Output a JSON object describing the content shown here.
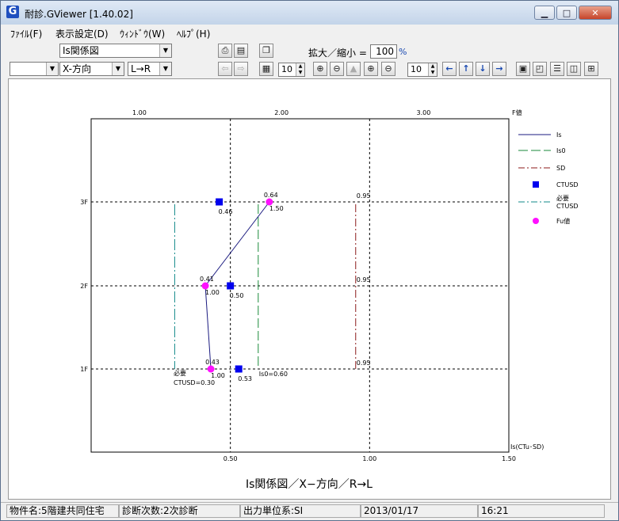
{
  "window": {
    "title": "耐診.GViewer [1.40.02]",
    "app_icon": "G",
    "minimize": "▁",
    "maximize": "□",
    "close": "✕"
  },
  "menu": {
    "items": [
      "ﾌｧｲﾙ(F)",
      "表示設定(D)",
      "ｳｨﾝﾄﾞｳ(W)",
      "ﾍﾙﾌﾟ(H)"
    ]
  },
  "toolbar": {
    "view_select": "Is関係図",
    "blank_select": "",
    "direction_select": "X-方向",
    "lr_select": "L→R",
    "zoom_label": "拡大／縮小 =",
    "zoom_value": "100",
    "zoom_unit": "%",
    "spin1_value": "10",
    "spin2_value": "10"
  },
  "chart_data": {
    "type": "scatter",
    "title": "Is関係図／X−方向／R→L",
    "bottom_axis": {
      "label": "Is(CTu･SD)",
      "ticks": [
        "0.50",
        "1.00",
        "1.50"
      ],
      "range": [
        0,
        1.5
      ]
    },
    "top_axis": {
      "label": "F値",
      "ticks": [
        "1.00",
        "2.00",
        "3.00"
      ],
      "range": [
        0.66,
        3.6
      ]
    },
    "y_axis": {
      "ticks": [
        "3F",
        "2F",
        "1F"
      ]
    },
    "grid": true,
    "legend_position": "right",
    "legend": [
      {
        "name": "Is",
        "kind": "line",
        "color": "#1a1a80"
      },
      {
        "name": "Is0",
        "kind": "longdash",
        "color": "#1a8a3a"
      },
      {
        "name": "SD",
        "kind": "dashdot",
        "color": "#8b1a1a"
      },
      {
        "name": "CTUSD",
        "kind": "square",
        "color": "#0000ee"
      },
      {
        "name": "必要\nCTUSD",
        "kind": "dashdot",
        "color": "#108888"
      },
      {
        "name": "Fu値",
        "kind": "circle",
        "color": "#ff10ff"
      }
    ],
    "is_series": [
      {
        "floor": "3F",
        "is": 0.64,
        "f": "1.50"
      },
      {
        "floor": "2F",
        "is": 0.41,
        "f": "1.00"
      },
      {
        "floor": "1F",
        "is": 0.43,
        "f": "1.00"
      }
    ],
    "ctusd": [
      {
        "floor": "3F",
        "value": 0.46
      },
      {
        "floor": "2F",
        "value": 0.5
      },
      {
        "floor": "1F",
        "value": 0.53
      }
    ],
    "is0": {
      "value": 0.6,
      "label": "Is0=0.60"
    },
    "sd": [
      {
        "floor": "3F",
        "value": 0.95
      },
      {
        "floor": "2F",
        "value": 0.95
      },
      {
        "floor": "1F",
        "value": 0.95
      }
    ],
    "required_ctusd": {
      "value": 0.3,
      "label1": "必要",
      "label2": "CTUSD=0.30"
    }
  },
  "status": {
    "property": "物件名:5階建共同住宅",
    "stage": "診断次数:2次診断",
    "units": "出力単位系:SI",
    "date": "2013/01/17",
    "time": "16:21"
  }
}
